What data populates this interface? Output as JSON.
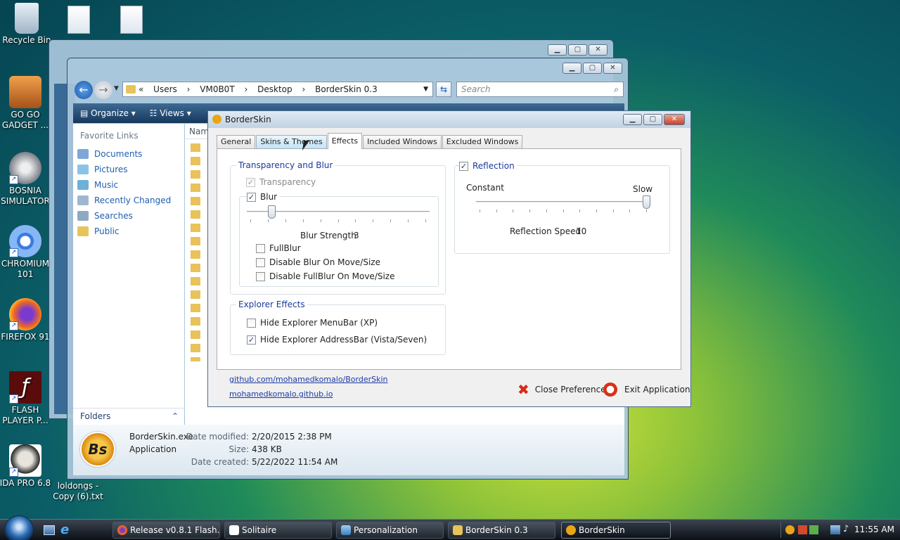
{
  "desktop": {
    "icons": [
      {
        "label": "Recycle Bin"
      },
      {
        "label": "GO GO GADGET ..."
      },
      {
        "label": "BOSNIA SIMULATOR"
      },
      {
        "label": "CHROMIUM 101"
      },
      {
        "label": "FIREFOX 91"
      },
      {
        "label": "FLASH PLAYER P..."
      },
      {
        "label": "IDA PRO 6.8"
      },
      {
        "label": "loldongs - Copy (6).txt"
      }
    ]
  },
  "explorer": {
    "breadcrumb": [
      "«",
      "Users",
      "VM0B0T",
      "Desktop",
      "BorderSkin 0.3"
    ],
    "search_placeholder": "Search",
    "toolbar": {
      "organize": "Organize",
      "views": "Views"
    },
    "favorite_links_title": "Favorite Links",
    "favorite_links": [
      "Documents",
      "Pictures",
      "Music",
      "Recently Changed",
      "Searches",
      "Public"
    ],
    "folders_label": "Folders",
    "column_name": "Nam",
    "details": {
      "file_name": "BorderSkin.exe",
      "file_type": "Application",
      "modified_label": "Date modified:",
      "modified_value": "2/20/2015 2:38 PM",
      "size_label": "Size:",
      "size_value": "438 KB",
      "created_label": "Date created:",
      "created_value": "5/22/2022 11:54 AM"
    }
  },
  "dialog": {
    "title": "BorderSkin",
    "tabs": [
      "General",
      "Skins & Themes",
      "Effects",
      "Included Windows",
      "Excluded Windows"
    ],
    "active_tab": "Effects",
    "transparency_group": {
      "title": "Transparency and Blur",
      "transparency_label": "Transparency",
      "blur_label": "Blur",
      "blur_strength_label": "Blur Strength",
      "blur_strength_value": "3",
      "blur_slider_fraction": 0.12,
      "fullblur_label": "FullBlur",
      "disable_blur_label": "Disable Blur On Move/Size",
      "disable_fullblur_label": "Disable FullBlur On Move/Size"
    },
    "explorer_effects": {
      "title": "Explorer Effects",
      "hide_menubar_label": "Hide Explorer MenuBar (XP)",
      "hide_addressbar_label": "Hide Explorer AddressBar (Vista/Seven)"
    },
    "reflection": {
      "title": "Reflection",
      "constant_label": "Constant",
      "slow_label": "Slow",
      "speed_label": "Reflection Speed",
      "speed_value": "10",
      "speed_slider_fraction": 1.0
    },
    "links": {
      "github": "github.com/mohamedkomalo/BorderSkin",
      "site": "mohamedkomalo.github.io"
    },
    "buttons": {
      "close_preference": "Close Preference",
      "exit_application": "Exit Application"
    }
  },
  "taskbar": {
    "items": [
      "Release v0.8.1 Flash...",
      "Solitaire",
      "Personalization",
      "BorderSkin 0.3",
      "BorderSkin"
    ],
    "clock": "11:55 AM"
  }
}
